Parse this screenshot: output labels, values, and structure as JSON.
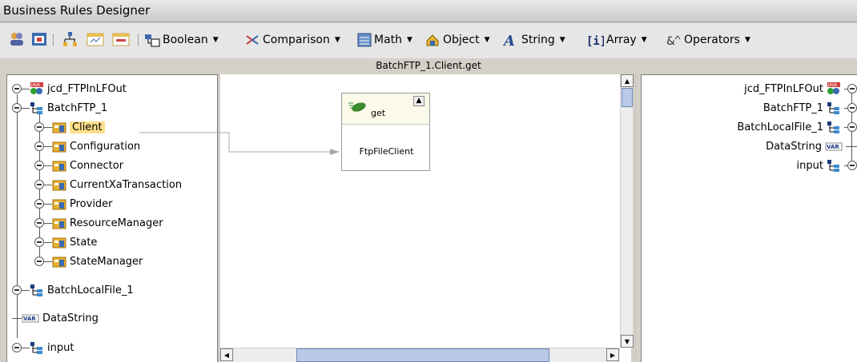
{
  "window": {
    "title": "Business Rules Designer"
  },
  "toolbar": {
    "menus": [
      {
        "label": "Boolean",
        "icon": "boolean-icon"
      },
      {
        "label": "Comparison",
        "icon": "comparison-icon"
      },
      {
        "label": "Math",
        "icon": "math-icon"
      },
      {
        "label": "Object",
        "icon": "object-icon"
      },
      {
        "label": "String",
        "icon": "string-icon"
      },
      {
        "label": "Array",
        "icon": "array-icon"
      },
      {
        "label": "Operators",
        "icon": "operators-icon"
      }
    ]
  },
  "canvas": {
    "path": "BatchFTP_1.Client.get"
  },
  "left_tree": {
    "items": [
      {
        "label": "jcd_FTPInLFOut",
        "icon": "java-collab-icon"
      },
      {
        "label": "BatchFTP_1",
        "icon": "otd-icon"
      },
      {
        "label": "Client",
        "icon": "class-icon",
        "selected": true
      },
      {
        "label": "Configuration",
        "icon": "class-icon"
      },
      {
        "label": "Connector",
        "icon": "class-icon"
      },
      {
        "label": "CurrentXaTransaction",
        "icon": "class-icon"
      },
      {
        "label": "Provider",
        "icon": "class-icon"
      },
      {
        "label": "ResourceManager",
        "icon": "class-icon"
      },
      {
        "label": "State",
        "icon": "class-icon"
      },
      {
        "label": "StateManager",
        "icon": "class-icon"
      },
      {
        "label": "BatchLocalFile_1",
        "icon": "otd-icon"
      },
      {
        "label": "DataString",
        "icon": "var-icon"
      },
      {
        "label": "input",
        "icon": "otd-icon"
      }
    ]
  },
  "method_box": {
    "title": "get",
    "field": "FtpFileClient"
  },
  "right_tree": {
    "items": [
      {
        "label": "jcd_FTPInLFOut"
      },
      {
        "label": "BatchFTP_1"
      },
      {
        "label": "BatchLocalFile_1"
      },
      {
        "label": "DataString"
      },
      {
        "label": "input"
      }
    ]
  }
}
